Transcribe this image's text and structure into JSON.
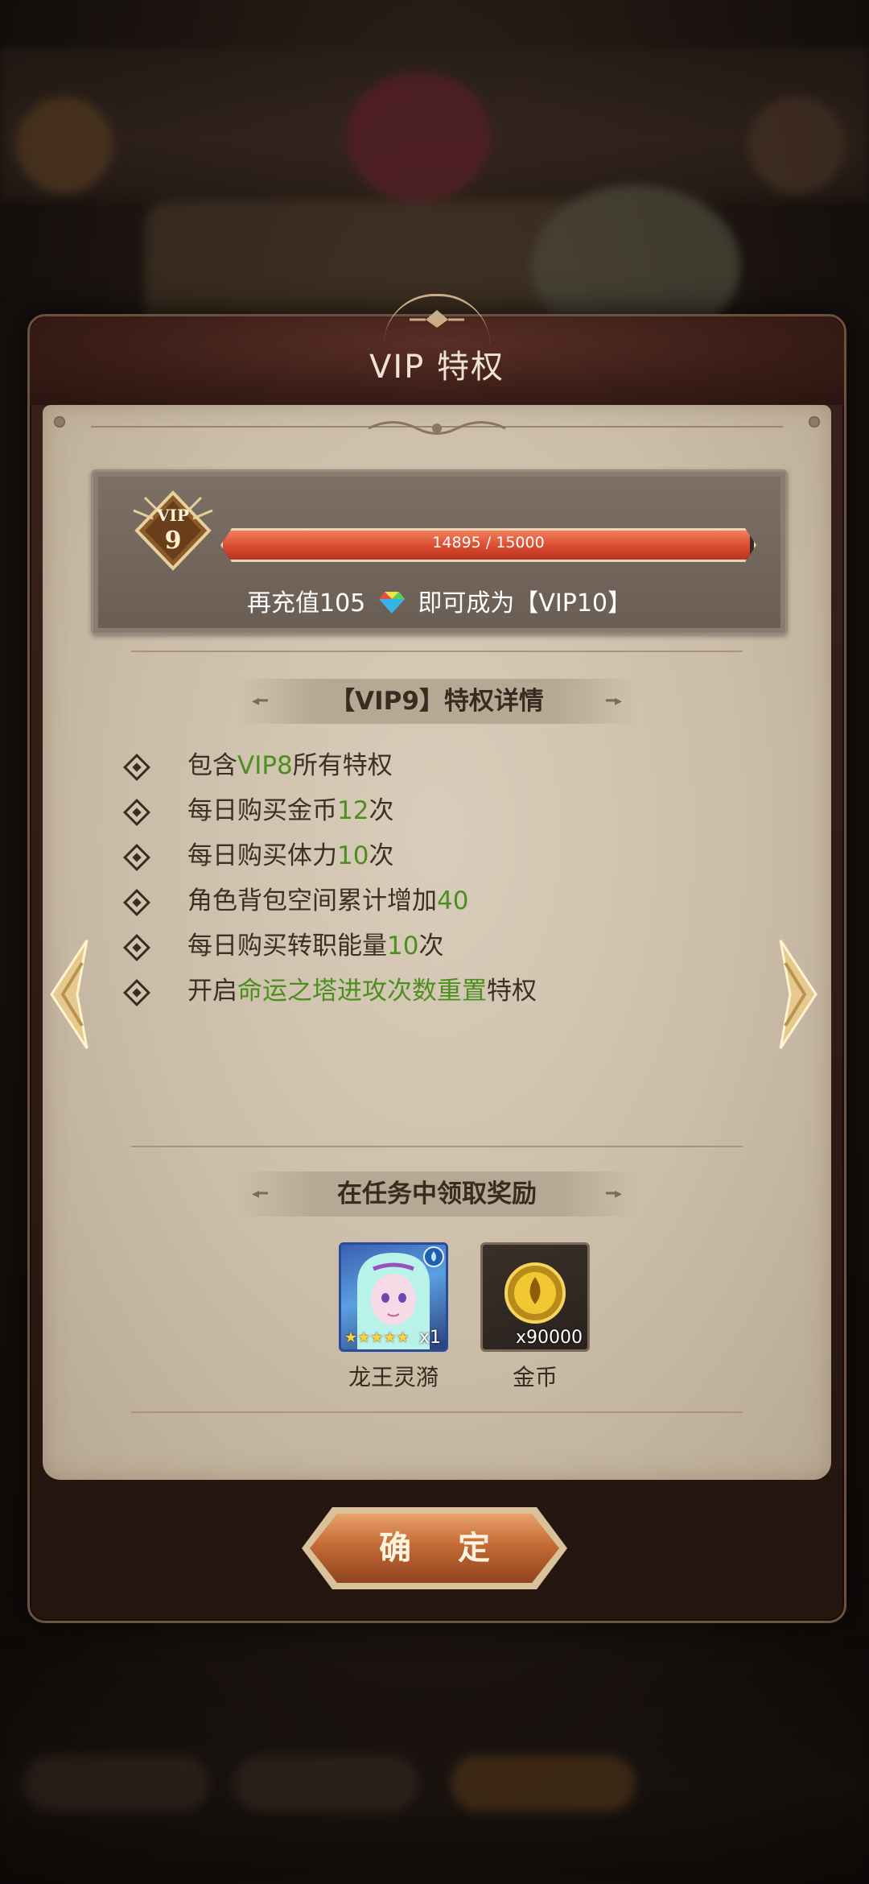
{
  "dialog": {
    "title": "VIP 特权",
    "vip_badge": {
      "label": "VIP",
      "level": "9"
    },
    "progress": {
      "text": "14895 / 15000",
      "current": 14895,
      "max": 15000,
      "fraction": 0.993
    },
    "recharge": {
      "prefix": "再充值105",
      "suffix": "即可成为【VIP10】"
    },
    "privilege_section_title": "【VIP9】特权详情",
    "privileges": [
      {
        "parts": [
          {
            "text": "包含",
            "hl": false
          },
          {
            "text": "VIP8",
            "hl": true
          },
          {
            "text": "所有特权",
            "hl": false
          }
        ]
      },
      {
        "parts": [
          {
            "text": "每日购买金币",
            "hl": false
          },
          {
            "text": "12",
            "hl": true
          },
          {
            "text": "次",
            "hl": false
          }
        ]
      },
      {
        "parts": [
          {
            "text": "每日购买体力",
            "hl": false
          },
          {
            "text": "10",
            "hl": true
          },
          {
            "text": "次",
            "hl": false
          }
        ]
      },
      {
        "parts": [
          {
            "text": "角色背包空间累计增加",
            "hl": false
          },
          {
            "text": "40",
            "hl": true
          }
        ]
      },
      {
        "parts": [
          {
            "text": "每日购买转职能量",
            "hl": false
          },
          {
            "text": "10",
            "hl": true
          },
          {
            "text": "次",
            "hl": false
          }
        ]
      },
      {
        "parts": [
          {
            "text": "开启",
            "hl": false
          },
          {
            "text": "命运之塔进攻次数重置",
            "hl": true
          },
          {
            "text": "特权",
            "hl": false
          }
        ]
      }
    ],
    "rewards_section_title": "在任务中领取奖励",
    "rewards": [
      {
        "name": "龙王灵漪",
        "count": "x1",
        "icon": "hero-portrait-icon",
        "stars": 5
      },
      {
        "name": "金币",
        "count": "x90000",
        "icon": "gold-coin-icon"
      }
    ],
    "confirm_label": "确 定"
  },
  "colors": {
    "highlight": "#4c8f1f",
    "panel": "#cbbda8",
    "progress_fill": "#d94b2f",
    "button": "#c56a35"
  }
}
